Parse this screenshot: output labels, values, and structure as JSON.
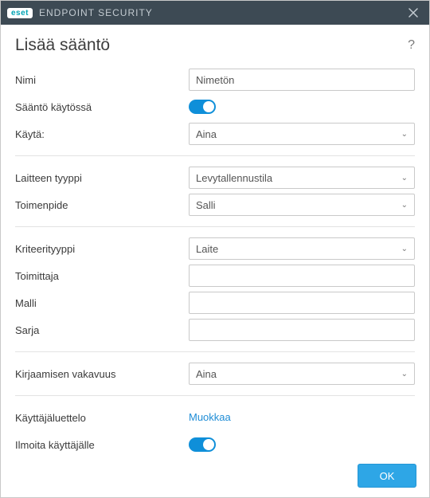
{
  "titlebar": {
    "brand_badge": "eset",
    "product": "ENDPOINT SECURITY"
  },
  "header": {
    "title": "Lisää sääntö"
  },
  "fields": {
    "name_label": "Nimi",
    "name_value": "Nimetön",
    "rule_enabled_label": "Sääntö käytössä",
    "apply_label": "Käytä:",
    "apply_value": "Aina",
    "device_type_label": "Laitteen tyyppi",
    "device_type_value": "Levytallennustila",
    "action_label": "Toimenpide",
    "action_value": "Salli",
    "criteria_type_label": "Kriteerityyppi",
    "criteria_type_value": "Laite",
    "vendor_label": "Toimittaja",
    "vendor_value": "",
    "model_label": "Malli",
    "model_value": "",
    "serial_label": "Sarja",
    "serial_value": "",
    "severity_label": "Kirjaamisen vakavuus",
    "severity_value": "Aina",
    "userlist_label": "Käyttäjäluettelo",
    "userlist_link": "Muokkaa",
    "notify_label": "Ilmoita käyttäjälle"
  },
  "footer": {
    "ok": "OK"
  }
}
